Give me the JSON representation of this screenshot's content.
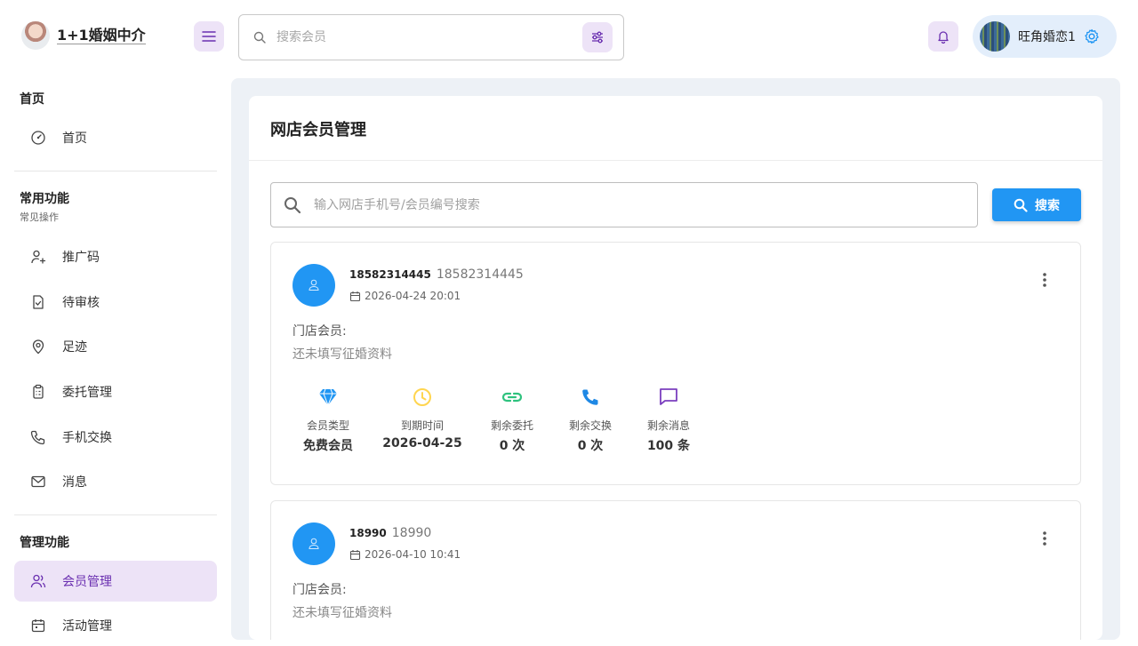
{
  "header": {
    "brand_name": "1+1婚姻中介",
    "search_placeholder": "搜索会员",
    "user_name": "旺角婚恋1"
  },
  "sidebar": {
    "sections": [
      {
        "title": "首页",
        "subtitle": "",
        "items": [
          {
            "label": "首页",
            "icon": "dashboard-icon"
          }
        ]
      },
      {
        "title": "常用功能",
        "subtitle": "常见操作",
        "items": [
          {
            "label": "推广码",
            "icon": "user-plus-icon"
          },
          {
            "label": "待审核",
            "icon": "file-check-icon"
          },
          {
            "label": "足迹",
            "icon": "map-pin-icon"
          },
          {
            "label": "委托管理",
            "icon": "clipboard-icon"
          },
          {
            "label": "手机交换",
            "icon": "phone-icon"
          },
          {
            "label": "消息",
            "icon": "mail-icon"
          }
        ]
      },
      {
        "title": "管理功能",
        "subtitle": "",
        "items": [
          {
            "label": "会员管理",
            "icon": "users-icon",
            "active": true
          },
          {
            "label": "活动管理",
            "icon": "calendar-icon"
          }
        ]
      }
    ]
  },
  "main": {
    "title": "网店会员管理",
    "search_placeholder": "输入网店手机号/会员编号搜索",
    "search_button": "搜索",
    "members": [
      {
        "phone": "18582314445",
        "name": "18582314445",
        "date": "2026-04-24 20:01",
        "store_label": "门店会员:",
        "note": "还未填写征婚资料",
        "stats": [
          {
            "label": "会员类型",
            "value": "免费会员",
            "icon": "diamond-icon",
            "color": "#2196f3"
          },
          {
            "label": "到期时间",
            "value": "2026-04-25",
            "icon": "clock-icon",
            "color": "#ffd54f"
          },
          {
            "label": "剩余委托",
            "value": "0 次",
            "icon": "link-icon",
            "color": "#2ec27e"
          },
          {
            "label": "剩余交换",
            "value": "0 次",
            "icon": "phone-icon",
            "color": "#1e88e5"
          },
          {
            "label": "剩余消息",
            "value": "100 条",
            "icon": "message-icon",
            "color": "#7b3fbf"
          }
        ]
      },
      {
        "phone": "18990",
        "name": "18990",
        "date": "2026-04-10 10:41",
        "store_label": "门店会员:",
        "note": "还未填写征婚资料"
      }
    ]
  },
  "colors": {
    "accent": "#2196f3",
    "purple": "#6a2fb0",
    "purple_bg": "#ede3f7",
    "main_bg": "#edf1f6"
  }
}
